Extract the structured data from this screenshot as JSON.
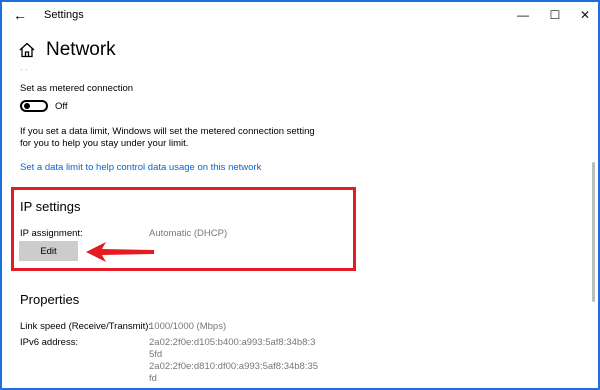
{
  "window": {
    "back_glyph": "←",
    "title": "Settings",
    "controls": {
      "minimize": "—",
      "maximize": "☐",
      "close": "✕"
    }
  },
  "page": {
    "title": "Network"
  },
  "metered": {
    "label": "Set as metered connection",
    "toggle_state": "Off",
    "description_line1": "If you set a data limit, Windows will set the metered connection setting",
    "description_line2": "for you to help you stay under your limit.",
    "data_limit_link": "Set a data limit to help control data usage on this network"
  },
  "ip_settings": {
    "heading": "IP settings",
    "assignment_label": "IP assignment:",
    "assignment_value": "Automatic (DHCP)",
    "edit_button": "Edit"
  },
  "properties": {
    "heading": "Properties",
    "link_speed_label": "Link speed (Receive/Transmit):",
    "link_speed_value": "1000/1000 (Mbps)",
    "ipv6_label": "IPv6 address:",
    "ipv6_value_lines": [
      "2a02:2f0e:d105:b400:a993:5af8:34b8:3",
      "5fd",
      "2a02:2f0e:d810:df00:a993:5af8:34b8:35",
      "fd"
    ]
  },
  "colors": {
    "accent_link": "#0a66c8",
    "highlight_border": "#e51b23",
    "arrow": "#e51b23",
    "desktop_frame": "#1f6fe0"
  },
  "icons": {
    "back": "arrow-left-icon",
    "home": "home-icon",
    "annotation": "red-arrow-icon"
  }
}
